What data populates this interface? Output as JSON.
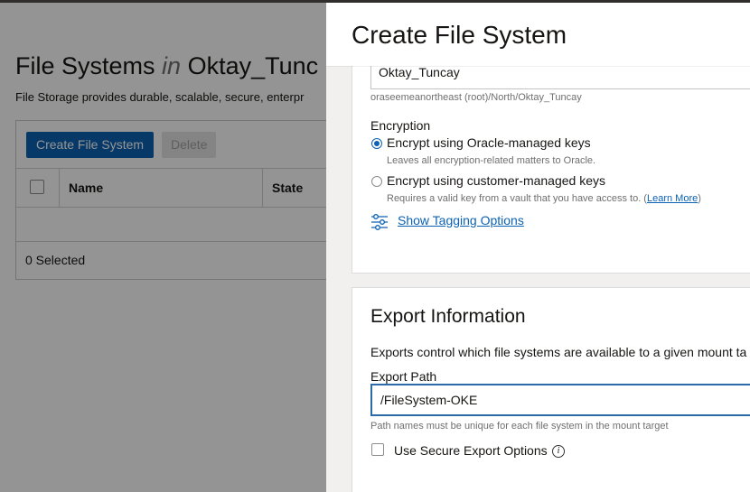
{
  "background_page": {
    "title_prefix": "File Systems",
    "title_in": "in",
    "title_compartment": "Oktay_Tunc",
    "subtitle": "File Storage provides durable, scalable, secure, enterpr",
    "create_button": "Create File System",
    "delete_button": "Delete",
    "columns": [
      "Name",
      "State"
    ],
    "selected_count": "0 Selected"
  },
  "drawer": {
    "title": "Create File System",
    "compartment": {
      "value": "Oktay_Tuncay",
      "path": "oraseemeanortheast (root)/North/Oktay_Tuncay"
    },
    "encryption": {
      "label": "Encryption",
      "option1_label": "Encrypt using Oracle-managed keys",
      "option1_help": "Leaves all encryption-related matters to Oracle.",
      "option2_label": "Encrypt using customer-managed keys",
      "option2_help": "Requires a valid key from a vault that you have access to. (",
      "option2_link": "Learn More",
      "option2_help_end": ")",
      "selected": "oracle-managed"
    },
    "tagging_link": "Show Tagging Options",
    "export": {
      "title": "Export Information",
      "description": "Exports control which file systems are available to a given mount ta",
      "path_label": "Export Path",
      "path_value": "/FileSystem-OKE",
      "path_help": "Path names must be unique for each file system in the mount target",
      "secure_label": "Use Secure Export Options"
    }
  },
  "colors": {
    "primary": "#0b62b4",
    "overlay": "rgba(0,0,0,0.42)",
    "topbar": "#312d2a"
  }
}
